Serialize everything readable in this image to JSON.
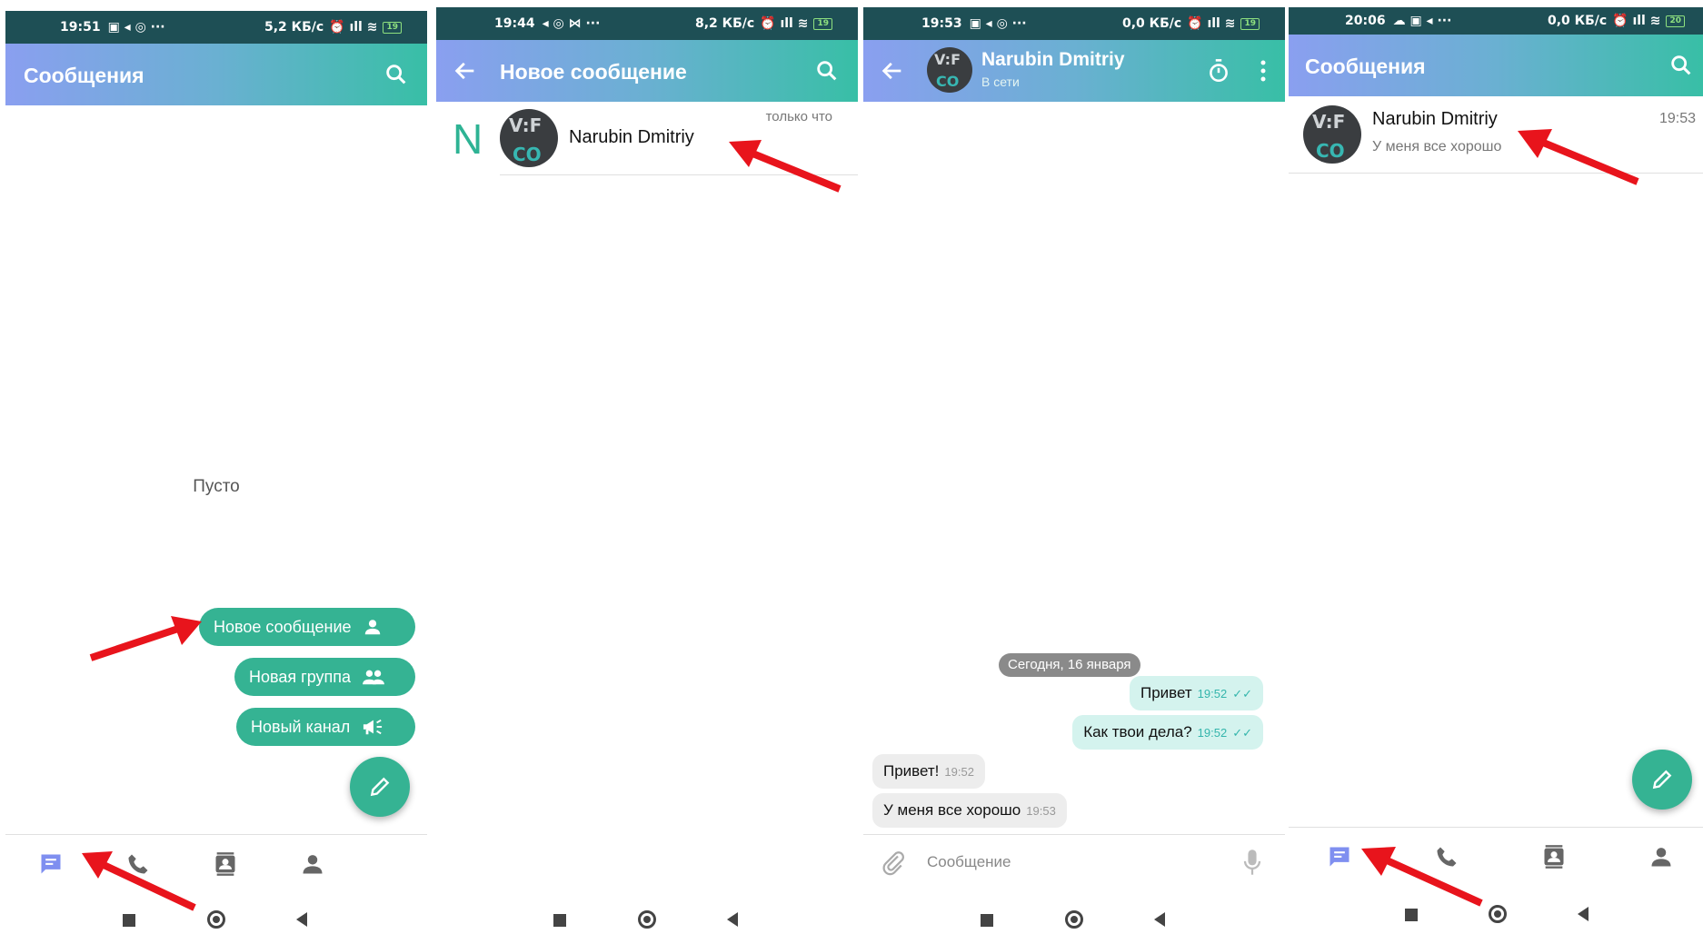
{
  "panels": [
    {
      "status": {
        "time": "19:51",
        "speed": "5,2 КБ/с",
        "battery": "19"
      },
      "title": "Сообщения",
      "empty_text": "Пусто",
      "menu": [
        {
          "label": "Новое сообщение",
          "icon": "person-icon"
        },
        {
          "label": "Новая группа",
          "icon": "group-icon"
        },
        {
          "label": "Новый канал",
          "icon": "megaphone-icon"
        }
      ]
    },
    {
      "status": {
        "time": "19:44",
        "speed": "8,2 КБ/с",
        "battery": "19"
      },
      "title": "Новое сообщение",
      "section_letter": "N",
      "contact": {
        "name": "Narubin Dmitriy",
        "time": "только что"
      }
    },
    {
      "status": {
        "time": "19:53",
        "speed": "0,0 КБ/с",
        "battery": "19"
      },
      "contact": {
        "name": "Narubin Dmitriy",
        "presence": "В сети"
      },
      "date_chip": "Сегодня, 16 января",
      "messages": [
        {
          "text": "Привет",
          "time": "19:52",
          "direction": "out"
        },
        {
          "text": "Как твои дела?",
          "time": "19:52",
          "direction": "out"
        },
        {
          "text": "Привет!",
          "time": "19:52",
          "direction": "in"
        },
        {
          "text": "У меня все хорошо",
          "time": "19:53",
          "direction": "in"
        }
      ],
      "composer_placeholder": "Сообщение"
    },
    {
      "status": {
        "time": "20:06",
        "speed": "0,0 КБ/с",
        "battery": "20"
      },
      "title": "Сообщения",
      "chat": {
        "name": "Narubin Dmitriy",
        "last_message": "У меня все хорошо",
        "time": "19:53"
      }
    }
  ],
  "avatar_text": {
    "top": "V:F",
    "bottom": "CO"
  },
  "colors": {
    "accent": "#35b393",
    "statusbar": "#1e4f55",
    "arrow": "#e8141c",
    "nav_active": "#7f8ff0"
  }
}
